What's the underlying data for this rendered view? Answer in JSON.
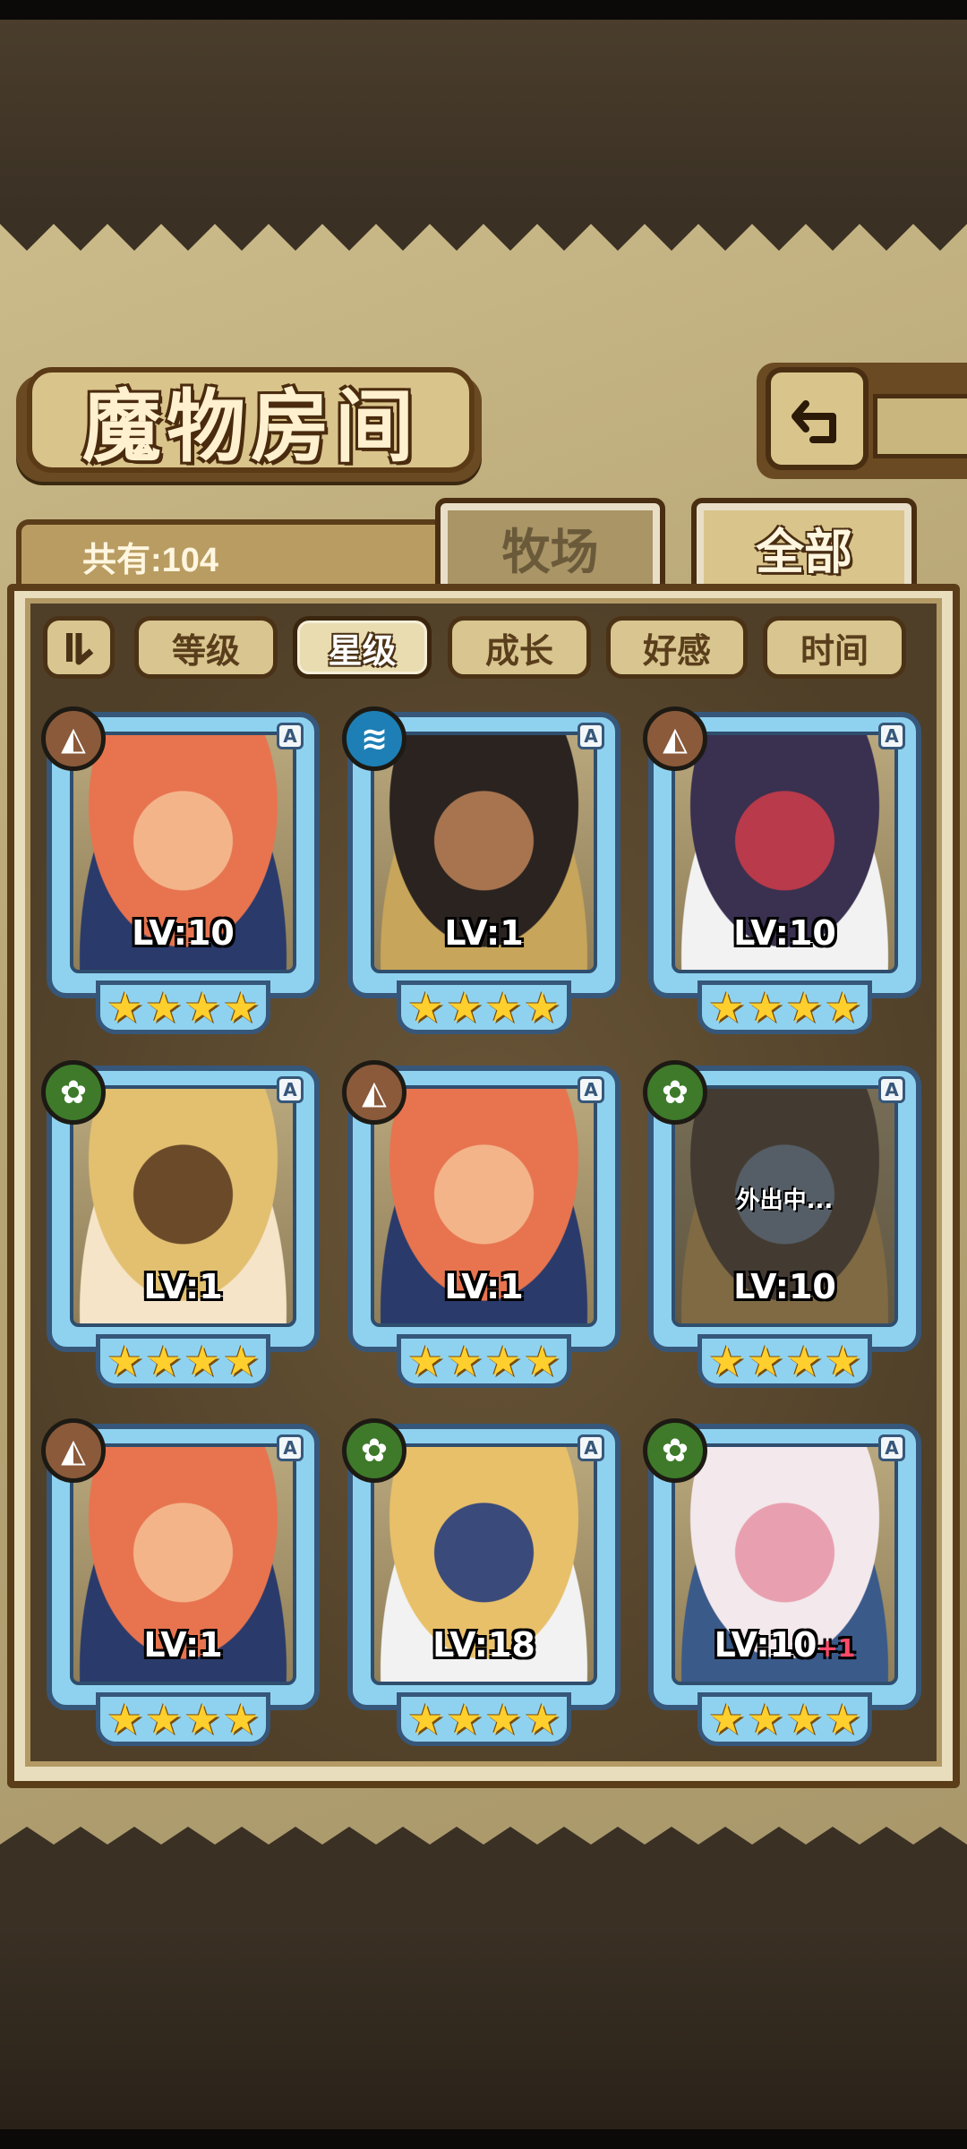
{
  "header": {
    "title": "魔物房间",
    "back_icon": "return-arrow-icon"
  },
  "summary": {
    "count_label": "共有:104"
  },
  "tabs": [
    {
      "label": "牧场",
      "selected": false
    },
    {
      "label": "全部",
      "selected": true
    }
  ],
  "sort": {
    "toggle_icon": "sort-order-icon",
    "buttons": [
      {
        "label": "等级",
        "active": false
      },
      {
        "label": "星级",
        "active": true
      },
      {
        "label": "成长",
        "active": false
      },
      {
        "label": "好感",
        "active": false
      },
      {
        "label": "时间",
        "active": false
      }
    ]
  },
  "cards": [
    {
      "element": "earth",
      "element_glyph": "◭",
      "grade": "A",
      "level": "LV:10",
      "plus": "",
      "stars": 4,
      "status": "",
      "art_colors": [
        "#e7744f",
        "#2a3a6a",
        "#f4b48a"
      ]
    },
    {
      "element": "water",
      "element_glyph": "≋",
      "grade": "A",
      "level": "LV:1",
      "plus": "",
      "stars": 4,
      "status": "",
      "art_colors": [
        "#2a2320",
        "#c7a55a",
        "#a7744f"
      ]
    },
    {
      "element": "earth",
      "element_glyph": "◭",
      "grade": "A",
      "level": "LV:10",
      "plus": "",
      "stars": 4,
      "status": "",
      "art_colors": [
        "#3a3050",
        "#f2f2f2",
        "#b93a4a"
      ]
    },
    {
      "element": "wood",
      "element_glyph": "✿",
      "grade": "A",
      "level": "LV:1",
      "plus": "",
      "stars": 4,
      "status": "",
      "art_colors": [
        "#e2c070",
        "#f5e4c8",
        "#6b4a2a"
      ]
    },
    {
      "element": "earth",
      "element_glyph": "◭",
      "grade": "A",
      "level": "LV:1",
      "plus": "",
      "stars": 4,
      "status": "",
      "art_colors": [
        "#e7744f",
        "#2a3a6a",
        "#f4b48a"
      ]
    },
    {
      "element": "wood",
      "element_glyph": "✿",
      "grade": "A",
      "level": "LV:10",
      "plus": "",
      "stars": 4,
      "status": "外出中...",
      "art_colors": [
        "#5a4a3a",
        "#c7a05a",
        "#7a8a9a"
      ]
    },
    {
      "element": "earth",
      "element_glyph": "◭",
      "grade": "A",
      "level": "LV:1",
      "plus": "",
      "stars": 4,
      "status": "",
      "art_colors": [
        "#e7744f",
        "#2a3a6a",
        "#f4b48a"
      ]
    },
    {
      "element": "wood",
      "element_glyph": "✿",
      "grade": "A",
      "level": "LV:18",
      "plus": "",
      "stars": 4,
      "status": "",
      "art_colors": [
        "#e8c06a",
        "#f2f2f2",
        "#3a4a7a"
      ]
    },
    {
      "element": "wood",
      "element_glyph": "✿",
      "grade": "A",
      "level": "LV:10",
      "plus": "+1",
      "stars": 4,
      "status": "",
      "art_colors": [
        "#f3e8ec",
        "#3a5a8a",
        "#e8a0b0"
      ]
    }
  ]
}
